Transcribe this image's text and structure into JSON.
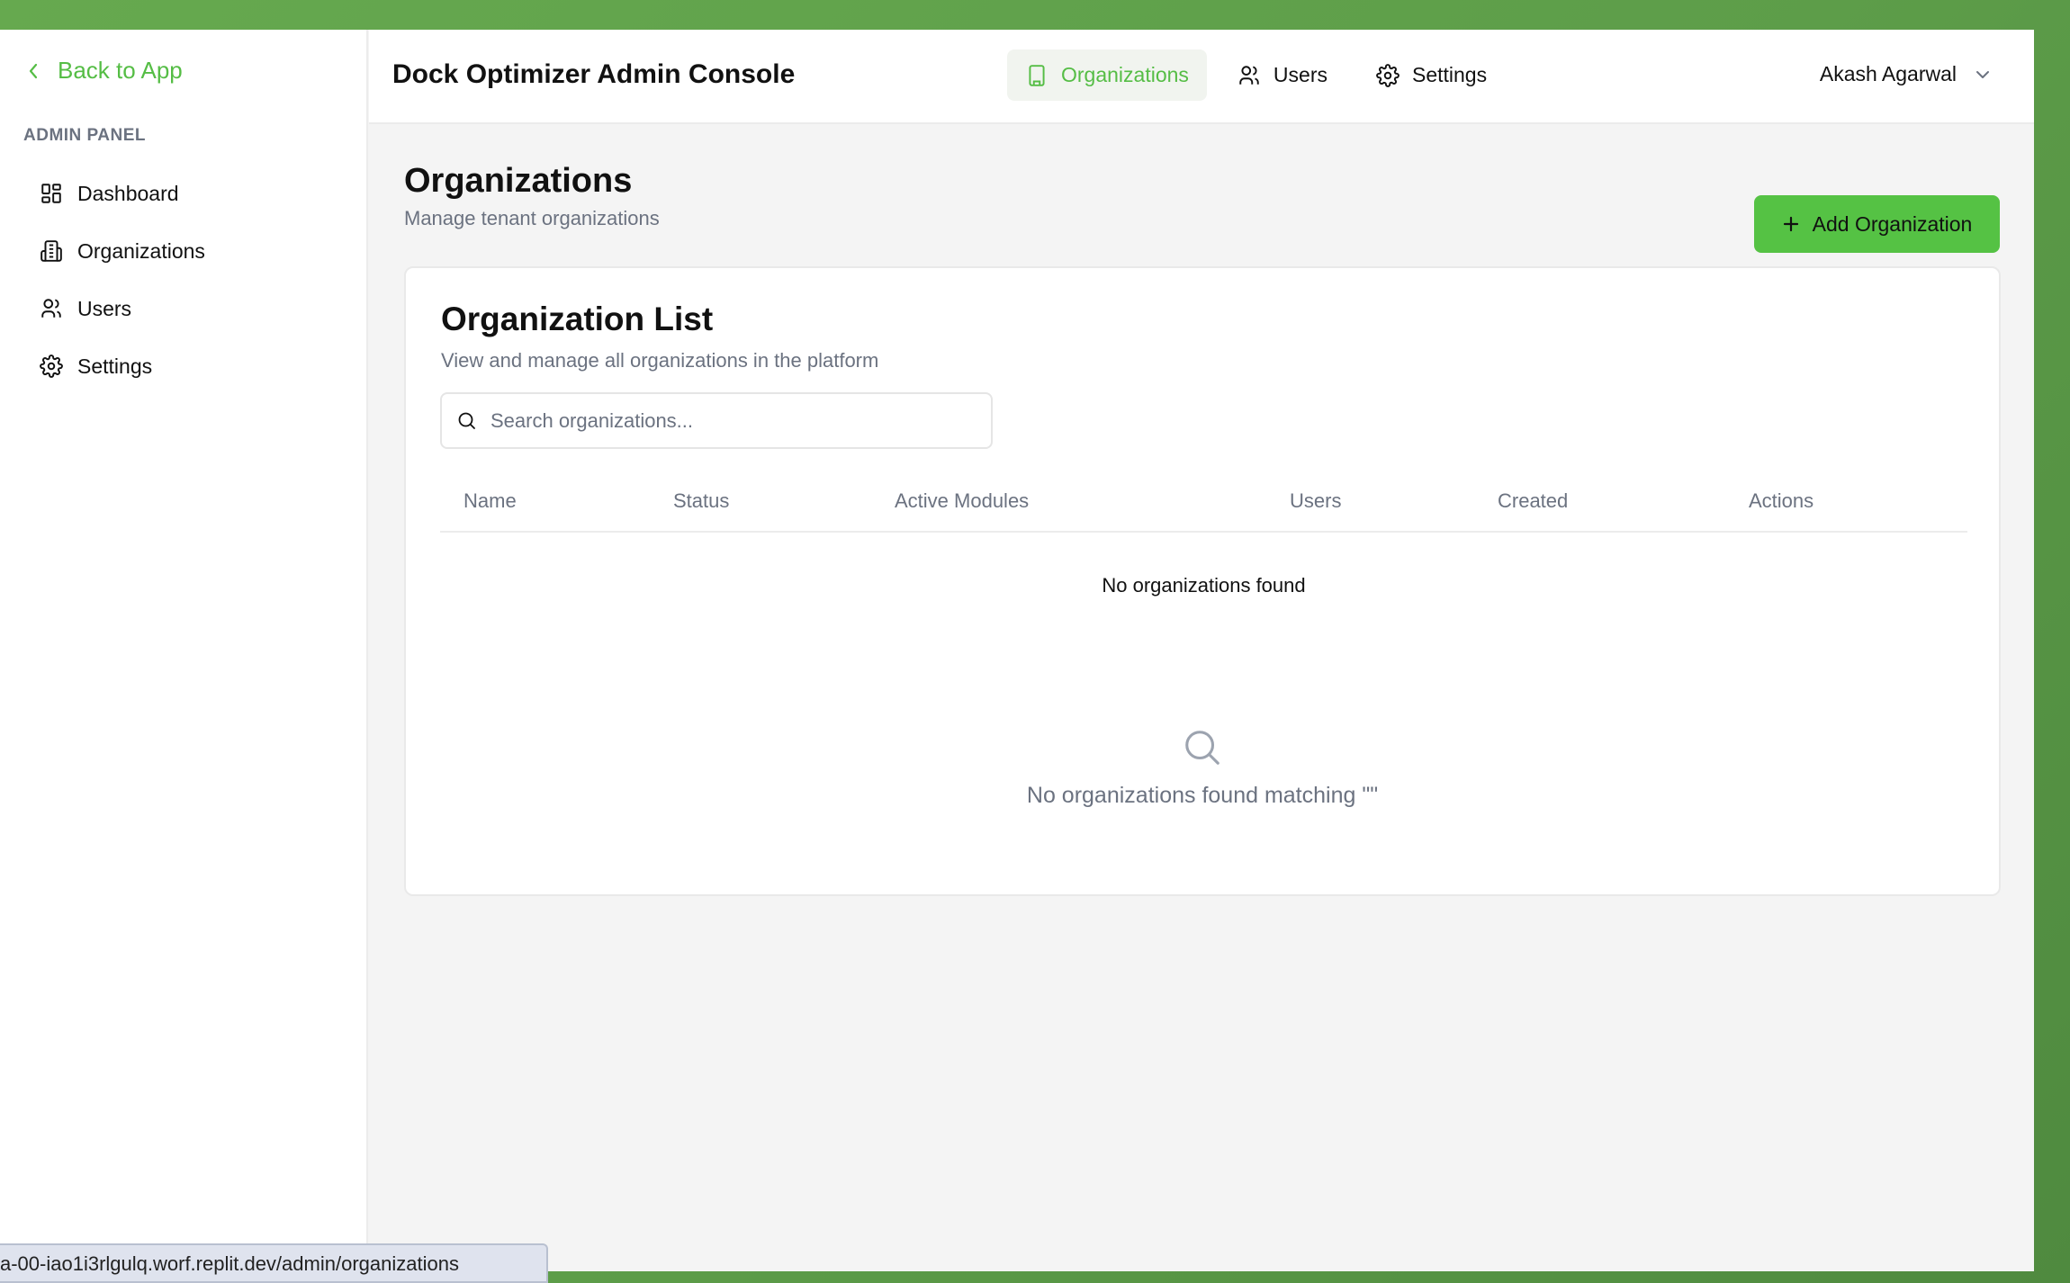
{
  "colors": {
    "accent": "#55bd45",
    "accent_button": "#55c244",
    "muted": "#6b7280"
  },
  "sidebar": {
    "back_label": "Back to App",
    "section_label": "ADMIN PANEL",
    "items": [
      {
        "label": "Dashboard",
        "icon": "dashboard-icon"
      },
      {
        "label": "Organizations",
        "icon": "building-icon"
      },
      {
        "label": "Users",
        "icon": "users-icon"
      },
      {
        "label": "Settings",
        "icon": "gear-icon"
      }
    ]
  },
  "header": {
    "title": "Dock Optimizer Admin Console",
    "nav": [
      {
        "label": "Organizations",
        "icon": "building-icon",
        "active": true
      },
      {
        "label": "Users",
        "icon": "users-icon",
        "active": false
      },
      {
        "label": "Settings",
        "icon": "gear-icon",
        "active": false
      }
    ],
    "user_name": "Akash Agarwal"
  },
  "page": {
    "title": "Organizations",
    "subtitle": "Manage tenant organizations",
    "add_button_label": "Add Organization"
  },
  "card": {
    "title": "Organization List",
    "description": "View and manage all organizations in the platform",
    "search_placeholder": "Search organizations...",
    "search_value": "",
    "columns": [
      "Name",
      "Status",
      "Active Modules",
      "Users",
      "Created",
      "Actions"
    ],
    "empty_row": "No organizations found",
    "empty_state_message": "No organizations found matching \"\""
  },
  "status_bar": {
    "url": "a-00-iao1i3rlgulq.worf.replit.dev/admin/organizations"
  }
}
